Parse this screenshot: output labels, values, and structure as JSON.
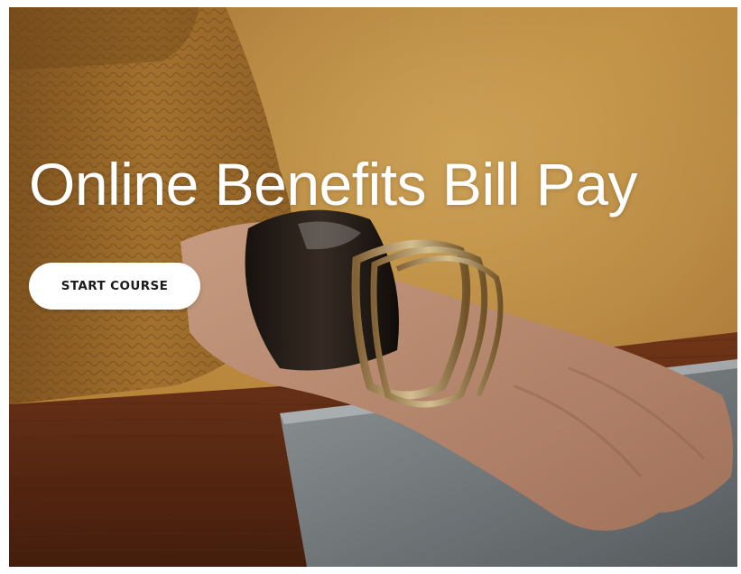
{
  "hero": {
    "title": "Online Benefits Bill Pay",
    "button_label": "START COURSE"
  },
  "colors": {
    "button_bg": "#ffffff",
    "button_text": "#1b1b1b",
    "title_text": "#ffffff"
  }
}
